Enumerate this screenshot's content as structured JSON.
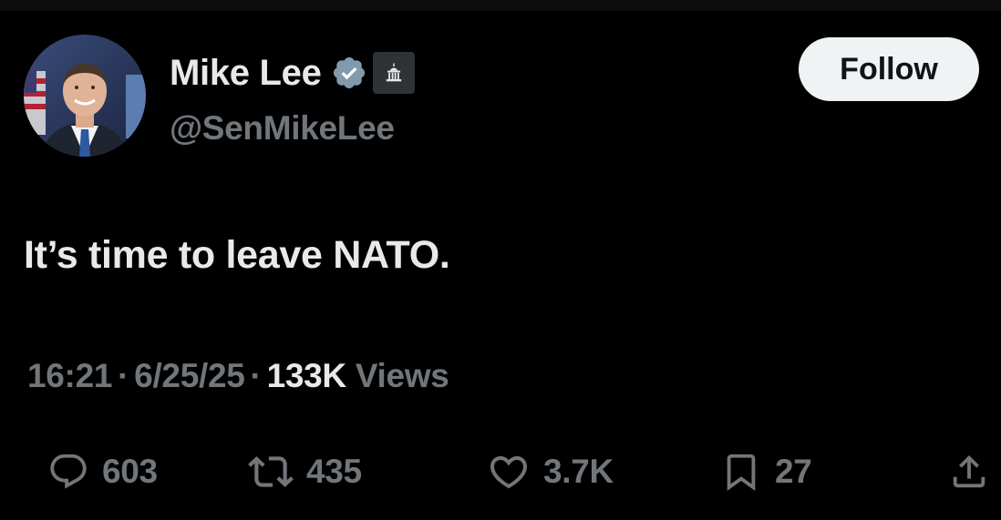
{
  "author": {
    "display_name": "Mike Lee",
    "handle": "@SenMikeLee",
    "verified_icon": "verified-badge-icon",
    "affiliation_icon": "capitol-building-icon"
  },
  "follow_button": {
    "label": "Follow"
  },
  "tweet": {
    "text": "It’s time to leave NATO.",
    "time": "16:21",
    "separator": "·",
    "date": "6/25/25",
    "views_count": "133K",
    "views_label": "Views"
  },
  "actions": {
    "replies": "603",
    "reposts": "435",
    "likes": "3.7K",
    "bookmarks": "27"
  },
  "colors": {
    "background": "#000000",
    "primary_text": "#e7e9ea",
    "secondary_text": "#71767b",
    "verified": "#829aab",
    "follow_bg": "#eff3f4"
  }
}
